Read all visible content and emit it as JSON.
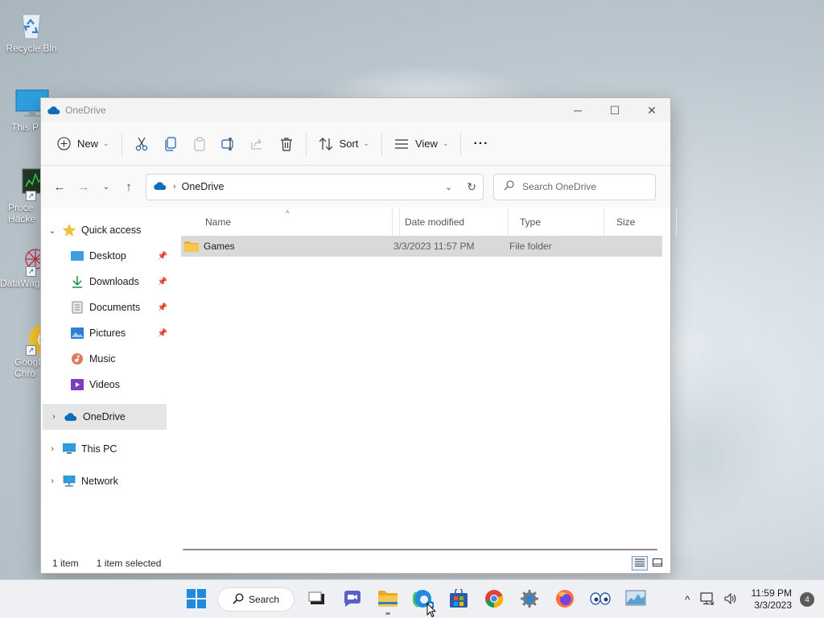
{
  "desktop": {
    "icons": [
      {
        "label": "Recycle Bin"
      },
      {
        "label": "This P"
      },
      {
        "label": "Proce\nHacke"
      },
      {
        "label": "DataWag"
      },
      {
        "label": "Googl\nChro"
      }
    ]
  },
  "window": {
    "title": "OneDrive",
    "controls": {
      "minimize": "─",
      "maximize": "☐",
      "close": "✕"
    },
    "commandbar": {
      "new_label": "New",
      "sort_label": "Sort",
      "view_label": "View",
      "more_label": "···"
    },
    "address": {
      "crumb": "OneDrive",
      "search_placeholder": "Search OneDrive"
    },
    "navpane": {
      "quick_access": "Quick access",
      "items": [
        {
          "label": "Desktop",
          "pinned": true
        },
        {
          "label": "Downloads",
          "pinned": true
        },
        {
          "label": "Documents",
          "pinned": true
        },
        {
          "label": "Pictures",
          "pinned": true
        },
        {
          "label": "Music",
          "pinned": false
        },
        {
          "label": "Videos",
          "pinned": false
        }
      ],
      "onedrive": "OneDrive",
      "thispc": "This PC",
      "network": "Network"
    },
    "columns": {
      "name": "Name",
      "date": "Date modified",
      "type": "Type",
      "size": "Size"
    },
    "rows": [
      {
        "name": "Games",
        "date": "3/3/2023 11:57 PM",
        "type": "File folder",
        "size": ""
      }
    ],
    "status": {
      "count": "1 item",
      "selected": "1 item selected"
    }
  },
  "taskbar": {
    "search_label": "Search",
    "time": "11:59 PM",
    "date": "3/3/2023",
    "notifications": "4"
  },
  "colors": {
    "accent": "#0067c0",
    "folder": "#f7c64a",
    "onedrive": "#0f6cbd",
    "selected_row": "#d9d9d9"
  }
}
